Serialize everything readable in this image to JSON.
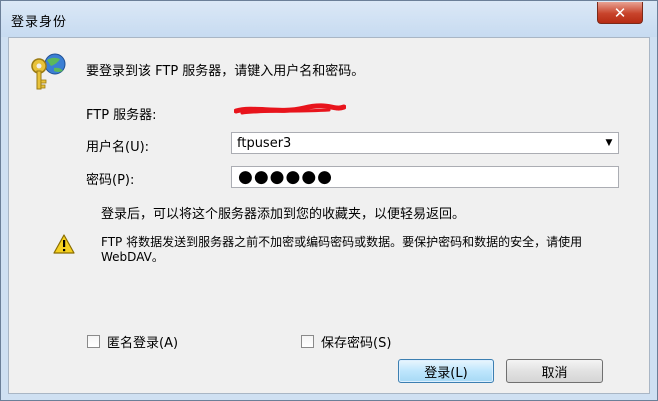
{
  "window": {
    "title": "登录身份",
    "close_label": "✕"
  },
  "dialog": {
    "intro": "要登录到该 FTP 服务器，请键入用户名和密码。",
    "server_label": "FTP 服务器:",
    "username_label": "用户名(U):",
    "username_value": "ftpuser3",
    "password_label": "密码(P):",
    "password_mask": "●●●●●●",
    "favorites_note": "登录后，可以将这个服务器添加到您的收藏夹，以便轻易返回。",
    "warning": "FTP 将数据发送到服务器之前不加密或编码密码或数据。要保护密码和数据的安全，请使用 WebDAV。",
    "anonymous_label": "匿名登录(A)",
    "save_password_label": "保存密码(S)",
    "login_button": "登录(L)",
    "cancel_button": "取消"
  },
  "colors": {
    "close": "#c8432b",
    "redaction": "#e8141c",
    "dialog_bg": "#f0f0f0"
  }
}
